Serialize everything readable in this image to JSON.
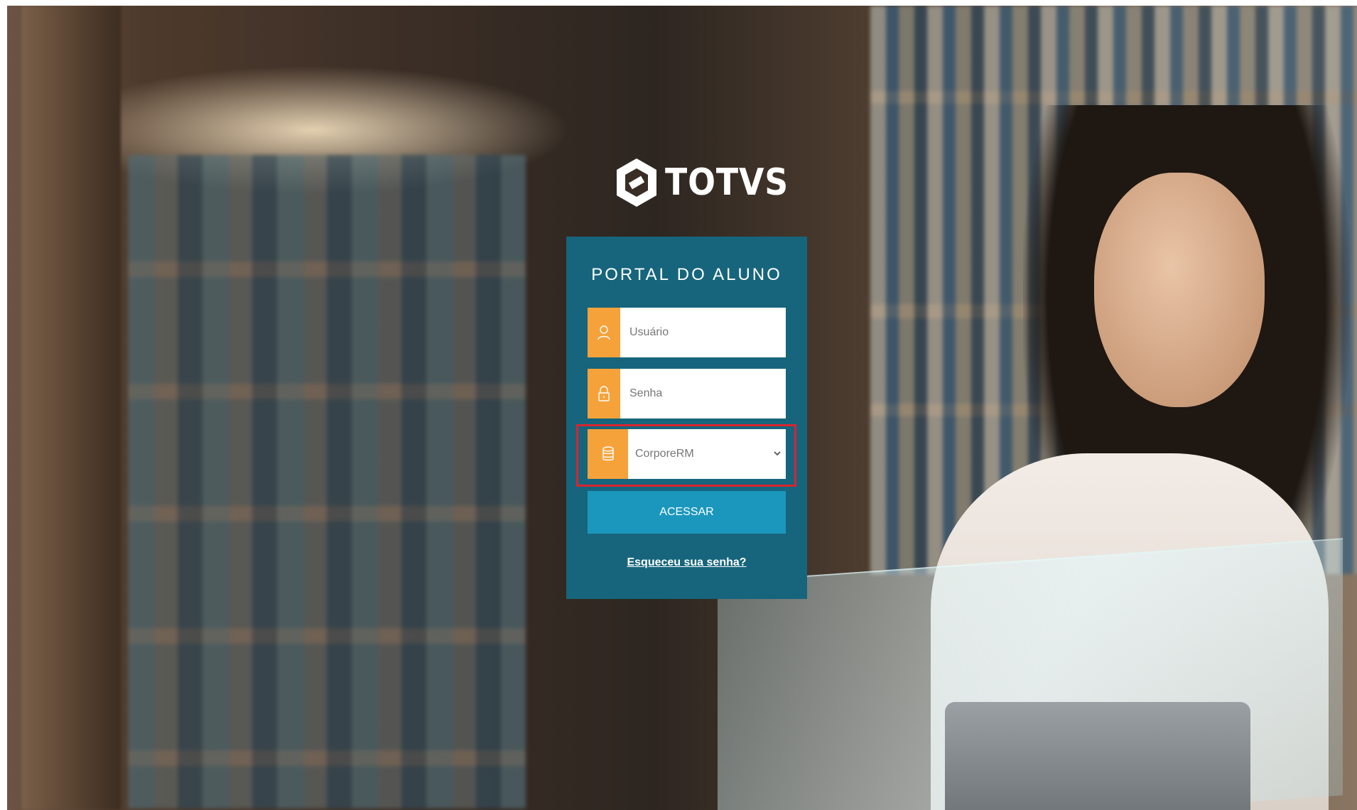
{
  "brand": {
    "logo_text": "TOTVS",
    "logo_icon": "totvs-logo-icon"
  },
  "login": {
    "title": "PORTAL DO ALUNO",
    "username": {
      "placeholder": "Usuário",
      "icon": "user-icon"
    },
    "password": {
      "placeholder": "Senha",
      "icon": "lock-icon"
    },
    "database": {
      "selected": "CorporeRM",
      "icon": "database-icon"
    },
    "submit_label": "ACESSAR",
    "forgot_label": "Esqueceu sua senha?"
  },
  "colors": {
    "card": "#16657c",
    "icon_box": "#f5a23a",
    "button": "#1b97bd",
    "highlight": "#d7252f"
  }
}
